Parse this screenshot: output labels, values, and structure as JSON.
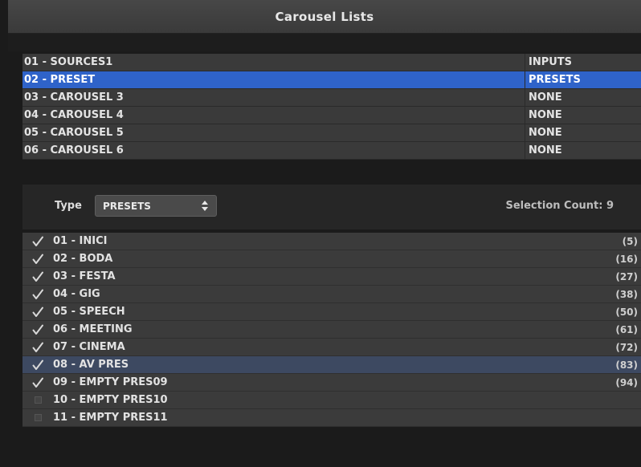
{
  "window": {
    "title": "Carousel Lists"
  },
  "carousels": [
    {
      "name": "01 - SOURCES1",
      "type": "INPUTS",
      "selected": false
    },
    {
      "name": "02 - PRESET",
      "type": "PRESETS",
      "selected": true
    },
    {
      "name": "03 - CAROUSEL 3",
      "type": "NONE",
      "selected": false
    },
    {
      "name": "04 - CAROUSEL 4",
      "type": "NONE",
      "selected": false
    },
    {
      "name": "05 - CAROUSEL 5",
      "type": "NONE",
      "selected": false
    },
    {
      "name": "06 - CAROUSEL 6",
      "type": "NONE",
      "selected": false
    }
  ],
  "type_bar": {
    "label": "Type",
    "selected_type": "PRESETS",
    "selection_count": "Selection Count: 9"
  },
  "presets": [
    {
      "name": "01 - INICI",
      "count": "(5)",
      "checked": true,
      "highlight": false
    },
    {
      "name": "02 - BODA",
      "count": "(16)",
      "checked": true,
      "highlight": false
    },
    {
      "name": "03 - FESTA",
      "count": "(27)",
      "checked": true,
      "highlight": false
    },
    {
      "name": "04 - GIG",
      "count": "(38)",
      "checked": true,
      "highlight": false
    },
    {
      "name": "05 - SPEECH",
      "count": "(50)",
      "checked": true,
      "highlight": false
    },
    {
      "name": "06 - MEETING",
      "count": "(61)",
      "checked": true,
      "highlight": false
    },
    {
      "name": "07 - CINEMA",
      "count": "(72)",
      "checked": true,
      "highlight": false
    },
    {
      "name": "08 - AV PRES",
      "count": "(83)",
      "checked": true,
      "highlight": true
    },
    {
      "name": "09 - EMPTY PRES09",
      "count": "(94)",
      "checked": true,
      "highlight": false
    },
    {
      "name": "10 - EMPTY PRES10",
      "count": "",
      "checked": false,
      "highlight": false
    },
    {
      "name": "11 - EMPTY PRES11",
      "count": "",
      "checked": false,
      "highlight": false
    }
  ],
  "colors": {
    "selection_blue": "#2f63c9",
    "row_highlight": "#3d4961"
  },
  "icons": {
    "check": "checkmark-icon",
    "empty": "empty-checkbox-icon",
    "stepper": "up-down-stepper-icon"
  }
}
